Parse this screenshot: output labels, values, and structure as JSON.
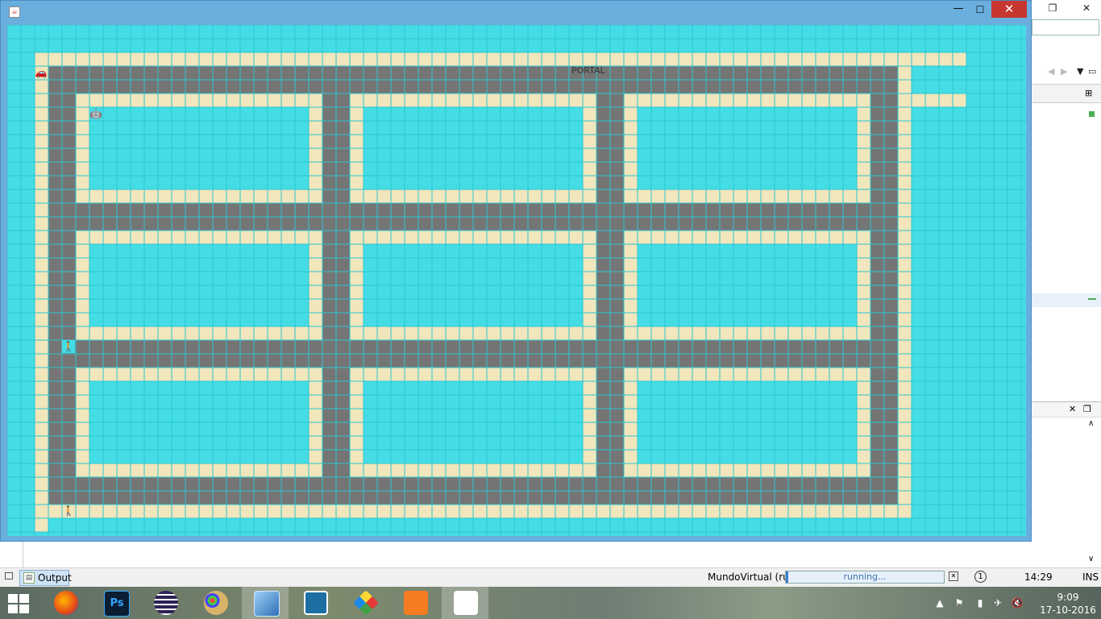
{
  "app_window": {
    "title": "",
    "minimize_glyph": "—",
    "maximize_glyph": "☐",
    "close_glyph": "✕"
  },
  "board": {
    "portal_label": "PORTAL",
    "colors": {
      "grass": "#44dde6",
      "sidewalk": "#f1e6bc",
      "road": "#757575",
      "grid": "#2bc6d1"
    },
    "sprites": [
      {
        "name": "car-sprite",
        "glyph": "🚗"
      },
      {
        "name": "robot-sprite",
        "glyph": "🤖"
      },
      {
        "name": "person-sprite",
        "glyph": "🚶"
      },
      {
        "name": "pedestrian-sprite",
        "glyph": "🚶"
      }
    ]
  },
  "ide": {
    "output_tab_label": "Output",
    "run_label": "MundoVirtual (run)",
    "progress_text": "running...",
    "caret_position": "14:29",
    "insert_mode": "INS"
  },
  "taskbar": {
    "apps": [
      {
        "name": "firefox",
        "label": ""
      },
      {
        "name": "photoshop",
        "label": "Ps"
      },
      {
        "name": "eclipse",
        "label": ""
      },
      {
        "name": "paint",
        "label": ""
      },
      {
        "name": "virtualbox",
        "label": ""
      },
      {
        "name": "brackets",
        "label": ""
      },
      {
        "name": "git",
        "label": ""
      },
      {
        "name": "xampp",
        "label": ""
      },
      {
        "name": "java",
        "label": ""
      }
    ],
    "clock_time": "9:09",
    "clock_date": "17-10-2016"
  }
}
